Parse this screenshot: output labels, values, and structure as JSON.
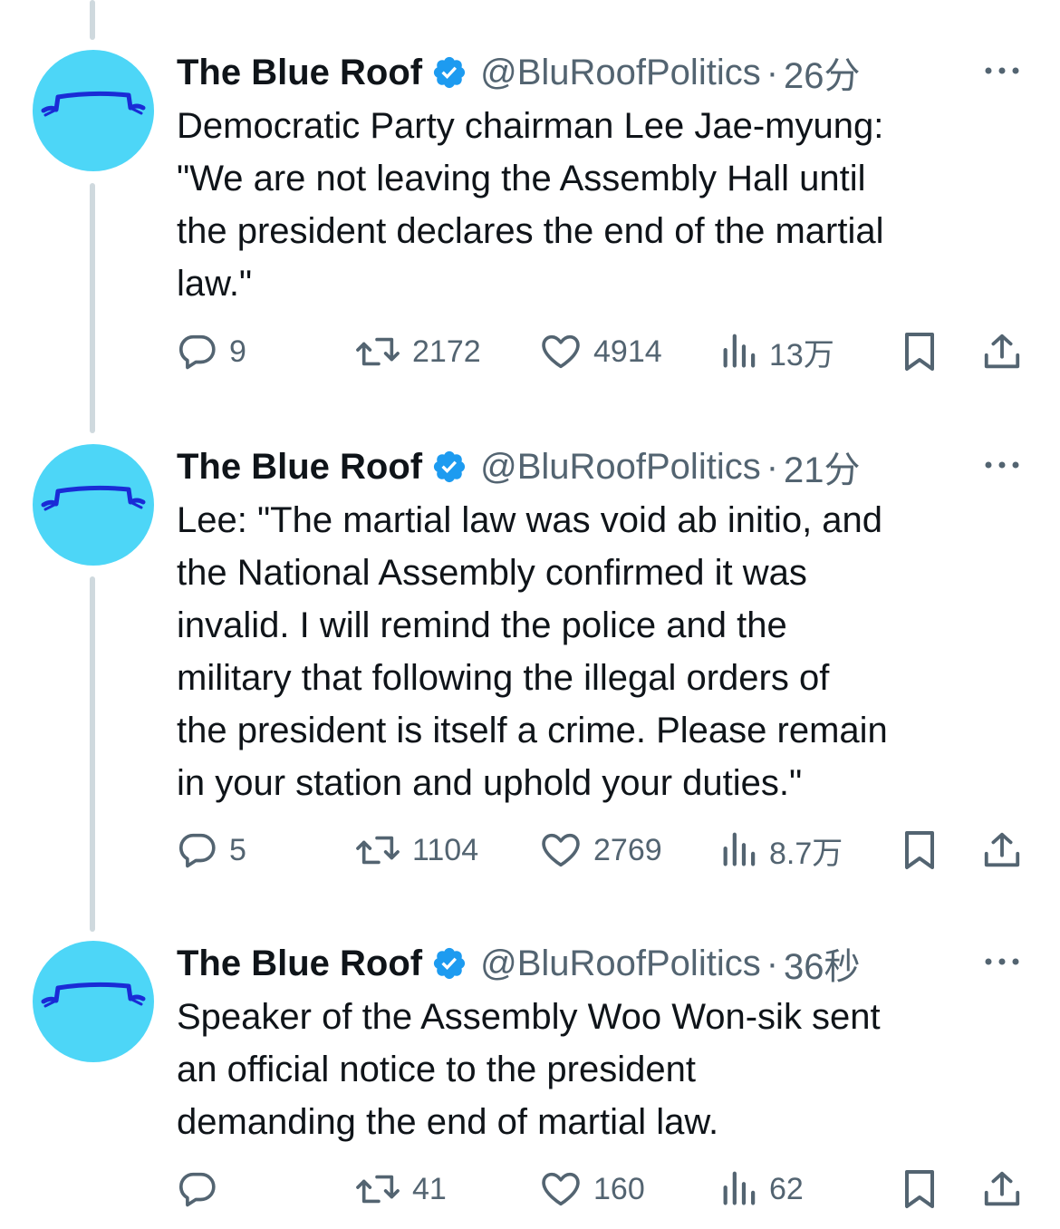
{
  "account": {
    "name": "The Blue Roof",
    "handle": "@BluRoofPolitics",
    "separator": "·"
  },
  "colors": {
    "avatar_bg": "#4dd6f7",
    "avatar_logo": "#1a2bd6",
    "verified": "#1d9bf0",
    "secondary_text": "#536471",
    "thread_line": "#cfd9de"
  },
  "icons": {
    "reply": "reply-icon",
    "retweet": "retweet-icon",
    "like": "heart-icon",
    "views": "views-chart-icon",
    "bookmark": "bookmark-icon",
    "share": "share-icon",
    "more": "more-icon",
    "verified": "verified-badge-icon"
  },
  "tweets": [
    {
      "time": "26分",
      "text": "Democratic Party chairman Lee Jae-myung:\n\"We are not leaving the Assembly Hall until\nthe president declares the end of the martial\nlaw.\"",
      "replies": "9",
      "retweets": "2172",
      "likes": "4914",
      "views": "13万"
    },
    {
      "time": "21分",
      "text": "Lee: \"The martial law was void ab initio, and\nthe National Assembly confirmed it was\ninvalid. I will remind the police and the\nmilitary that following the illegal orders of\nthe president is itself a crime. Please remain\nin your station and uphold your duties.\"",
      "replies": "5",
      "retweets": "1104",
      "likes": "2769",
      "views": "8.7万"
    },
    {
      "time": "36秒",
      "text": "Speaker of the Assembly Woo Won-sik sent\nan official notice to the president\ndemanding the end of martial law.",
      "replies": "",
      "retweets": "41",
      "likes": "160",
      "views": "62"
    }
  ]
}
